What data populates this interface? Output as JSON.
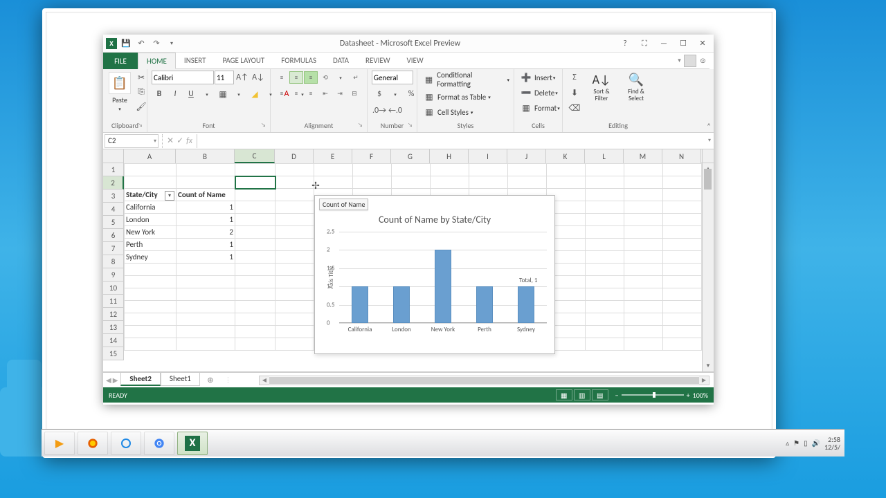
{
  "titlebar": {
    "document_title": "Datasheet - Microsoft Excel Preview",
    "qa_save": "💾",
    "qa_undo": "↶",
    "qa_redo": "↷",
    "help": "?",
    "touch": "⛶",
    "min": "—",
    "max": "☐",
    "close": "✕"
  },
  "ribbon": {
    "file": "FILE",
    "tabs": [
      "HOME",
      "INSERT",
      "PAGE LAYOUT",
      "FORMULAS",
      "DATA",
      "REVIEW",
      "VIEW"
    ],
    "active_tab": "HOME",
    "clipboard": {
      "paste": "Paste",
      "label": "Clipboard"
    },
    "font": {
      "name": "Calibri",
      "size": "11",
      "label": "Font"
    },
    "alignment": {
      "label": "Alignment"
    },
    "number": {
      "format": "General",
      "label": "Number"
    },
    "styles": {
      "cond": "Conditional Formatting",
      "table": "Format as Table",
      "cell": "Cell Styles",
      "label": "Styles"
    },
    "cells": {
      "insert": "Insert",
      "delete": "Delete",
      "format": "Format",
      "label": "Cells"
    },
    "editing": {
      "sort": "Sort & Filter",
      "find": "Find & Select",
      "label": "Editing"
    }
  },
  "formulabar": {
    "namebox": "C2",
    "fx": "fx",
    "value": ""
  },
  "columns": [
    {
      "name": "A",
      "w": 75
    },
    {
      "name": "B",
      "w": 85
    },
    {
      "name": "C",
      "w": 58
    },
    {
      "name": "D",
      "w": 56
    },
    {
      "name": "E",
      "w": 56
    },
    {
      "name": "F",
      "w": 56
    },
    {
      "name": "G",
      "w": 56
    },
    {
      "name": "H",
      "w": 56
    },
    {
      "name": "I",
      "w": 56
    },
    {
      "name": "J",
      "w": 56
    },
    {
      "name": "K",
      "w": 56
    },
    {
      "name": "L",
      "w": 56
    },
    {
      "name": "M",
      "w": 56
    },
    {
      "name": "N",
      "w": 56
    }
  ],
  "selected_col": "C",
  "selected_row": 2,
  "visible_rows": 15,
  "pivot": {
    "header_state": "State/City",
    "header_count": "Count of Name",
    "rows": [
      {
        "label": "California",
        "value": 1
      },
      {
        "label": "London",
        "value": 1
      },
      {
        "label": "New York",
        "value": 2
      },
      {
        "label": "Perth",
        "value": 1
      },
      {
        "label": "Sydney",
        "value": 1
      }
    ]
  },
  "chart_data": {
    "type": "bar",
    "button_label": "Count of Name",
    "title": "Count of Name by State/City",
    "ylabel": "Axis Title",
    "ylim": [
      0,
      2.5
    ],
    "ytick_step": 0.5,
    "categories": [
      "California",
      "London",
      "New York",
      "Perth",
      "Sydney"
    ],
    "values": [
      1,
      1,
      2,
      1,
      1
    ],
    "annotation": "Total, 1"
  },
  "sheets": {
    "tabs": [
      "Sheet2",
      "Sheet1"
    ],
    "active": "Sheet2"
  },
  "statusbar": {
    "text": "READY",
    "zoom": "100%"
  },
  "taskbar": {
    "clock": "2:58",
    "date": "12/5/"
  }
}
